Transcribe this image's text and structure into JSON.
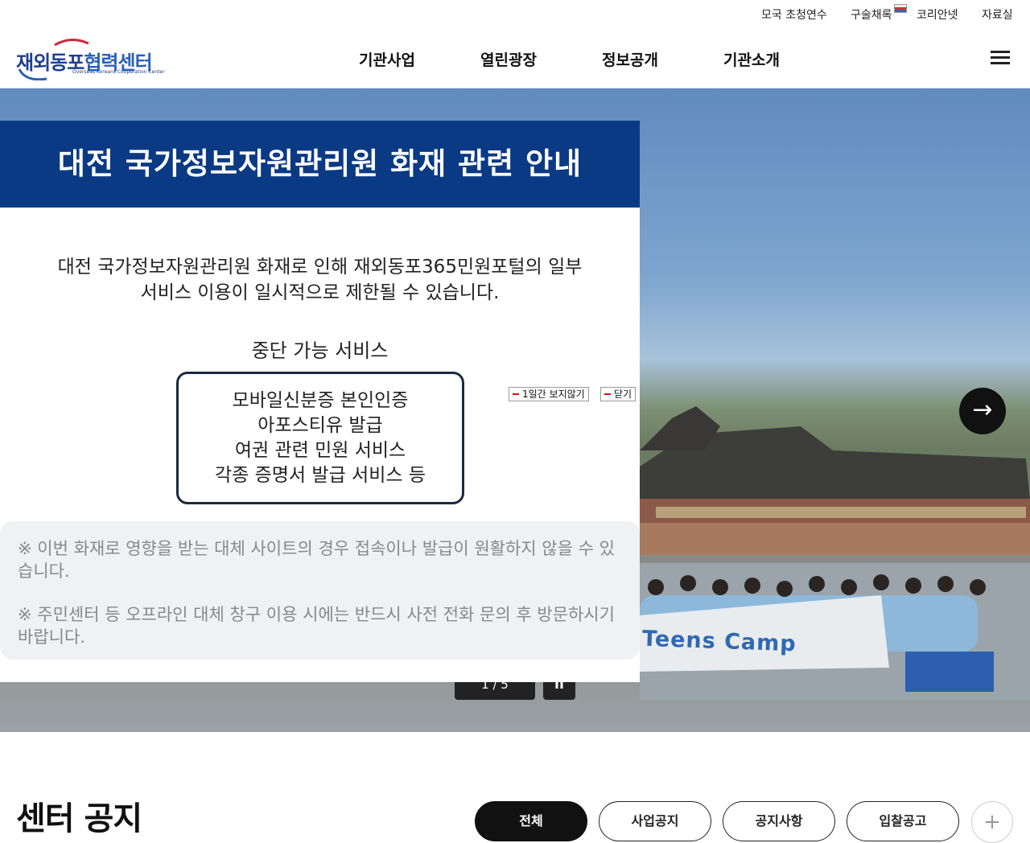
{
  "utility_nav": [
    {
      "label": "모국 초청연수"
    },
    {
      "label": "구술채록"
    },
    {
      "label": "코리안넷"
    },
    {
      "label": "자료실"
    }
  ],
  "logo": {
    "korean": "재외동포",
    "korean_suffix": "협력센터",
    "english": "Overseas Koreans Cooperation Center"
  },
  "main_nav": [
    {
      "label": "기관사업"
    },
    {
      "label": "열린광장"
    },
    {
      "label": "정보공개"
    },
    {
      "label": "기관소개"
    }
  ],
  "hero": {
    "banner_text": "Teens Camp",
    "pager": "1 / 5",
    "pause_label": "II",
    "next_label": "→"
  },
  "popup": {
    "title": "대전 국가정보자원관리원 화재 관련 안내",
    "line1": "대전 국가정보자원관리원 화재로 인해 재외동포365민원포털의 일부",
    "line2": "서비스 이용이 일시적으로 제한될 수 있습니다.",
    "services_title": "중단 가능 서비스",
    "services": [
      "모바일신분증 본인인증",
      "아포스티유 발급",
      "여권 관련 민원 서비스",
      "각종 증명서 발급 서비스 등"
    ],
    "note1": "※ 이번 화재로 영향을 받는 대체 사이트의 경우 접속이나 발급이 원활하지 않을 수 있습니다.",
    "note2": "※ 주민센터 등 오프라인 대체 창구 이용 시에는 반드시 사전 전화 문의 후 방문하시기 바랍니다.",
    "hide_day_label": "1일간 보지않기",
    "close_label": "닫기"
  },
  "notice": {
    "title": "센터 공지",
    "tabs": [
      {
        "label": "전체",
        "active": true
      },
      {
        "label": "사업공지"
      },
      {
        "label": "공지사항"
      },
      {
        "label": "입찰공고"
      }
    ],
    "more_label": "+"
  },
  "colors": {
    "brand_navy": "#0b3a84",
    "logo_blue": "#1e3f8f",
    "logo_red": "#d0263a"
  }
}
